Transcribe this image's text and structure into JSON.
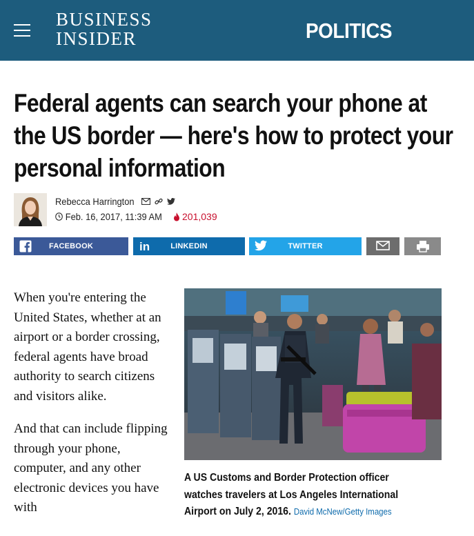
{
  "header": {
    "brand_line1": "BUSINESS",
    "brand_line2": "INSIDER",
    "section": "POLITICS",
    "menu_icon": "hamburger-menu-icon",
    "bar_color": "#1d5c7d"
  },
  "article": {
    "headline_lines": [
      "Federal agents can search your phone at",
      "the US border — here's how to protect your",
      "personal information"
    ],
    "author": "Rebecca Harrington",
    "date": "Feb. 16, 2017, 11:39 AM",
    "views": "201,039",
    "paragraphs": [
      "When you're entering the United States, whether at an airport or a border crossing, federal agents have broad authority to search citizens and visitors alike.",
      "And that can include flipping through your phone, computer, and any other electronic devices you have with"
    ],
    "caption": "A US Customs and Border Protection officer watches travelers at Los Angeles International Airport on July 2, 2016.",
    "credit": "David McNew/Getty Images"
  },
  "share": {
    "facebook": "FACEBOOK",
    "linkedin": "LINKEDIN",
    "twitter": "TWITTER",
    "colors": {
      "facebook": "#3b5998",
      "linkedin": "#0e6bac",
      "twitter": "#23a4e8",
      "email": "#6d6d6d",
      "print": "#8a8a8a"
    }
  }
}
